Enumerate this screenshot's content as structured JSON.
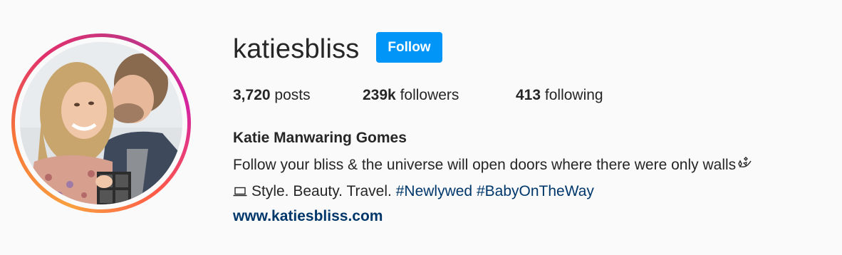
{
  "profile": {
    "username": "katiesbliss",
    "follow_label": "Follow",
    "full_name": "Katie Manwaring Gomes",
    "website": "www.katiesbliss.com"
  },
  "stats": {
    "posts_count": "3,720",
    "posts_label": "posts",
    "followers_count": "239k",
    "followers_label": "followers",
    "following_count": "413",
    "following_label": "following"
  },
  "bio": {
    "line1": "Follow your bliss & the universe will open doors where there were only walls",
    "line2_text": "Style. Beauty. Travel.",
    "hashtag1": "#Newlywed",
    "hashtag2": "#BabyOnTheWay"
  },
  "icons": {
    "line1_end": "sparkle-icon",
    "line2_start": "laptop-icon"
  },
  "colors": {
    "follow_button": "#0095f6",
    "link": "#00376b",
    "text": "#262626",
    "background": "#fafafa"
  }
}
